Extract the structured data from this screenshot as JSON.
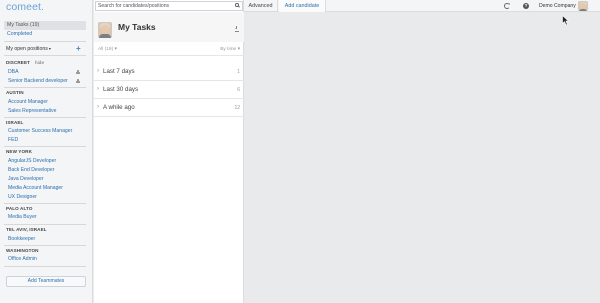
{
  "app": {
    "logo_text": "comeet."
  },
  "sidebar": {
    "nav": [
      {
        "label": "My Tasks (19)",
        "active": true
      },
      {
        "label": "Completed",
        "active": false
      }
    ],
    "positions_header": "My open positions",
    "add_position_label": "+",
    "groups": [
      {
        "label": "DISCREET",
        "hide_label": "hide",
        "items": [
          {
            "label": "DBA",
            "locked": true
          },
          {
            "label": "Senior Backend developer",
            "locked": true
          }
        ]
      },
      {
        "label": "AUSTIN",
        "items": [
          {
            "label": "Account Manager"
          },
          {
            "label": "Sales Representative"
          }
        ]
      },
      {
        "label": "ISRAEL",
        "items": [
          {
            "label": "Customer Success Manager"
          },
          {
            "label": "FED"
          }
        ]
      },
      {
        "label": "NEW YORK",
        "items": [
          {
            "label": "AngularJS Developer"
          },
          {
            "label": "Back End Developer"
          },
          {
            "label": "Java Developer"
          },
          {
            "label": "Media Account Manager"
          },
          {
            "label": "UX Designer"
          }
        ]
      },
      {
        "label": "PALO ALTO",
        "items": [
          {
            "label": "Media Buyer"
          }
        ]
      },
      {
        "label": "TEL AVIV, ISRAEL",
        "items": [
          {
            "label": "Bookkeeper"
          }
        ]
      },
      {
        "label": "WASHINGTON",
        "items": [
          {
            "label": "Office Admin"
          }
        ]
      }
    ],
    "add_teammates_label": "Add Teammates"
  },
  "tasks": {
    "search_placeholder": "Search for candidates/positions",
    "title": "My Tasks",
    "filter_label": "All (19)",
    "sort_label": "By time",
    "groups": [
      {
        "label": "Last 7 days",
        "count": "1"
      },
      {
        "label": "Last 30 days",
        "count": "6"
      },
      {
        "label": "A while ago",
        "count": "12"
      }
    ]
  },
  "topbar": {
    "advanced_label": "Advanced",
    "add_candidate_label": "Add candidate",
    "help_glyph": "?",
    "company_name": "Demo Company"
  },
  "colors": {
    "brand": "#3d7fc1",
    "link": "#2c6fb0",
    "sidebar_bg": "#f4f5f6",
    "canvas_bg": "#e9eaec"
  },
  "icons": [
    "search-icon",
    "download-icon",
    "refresh-icon",
    "help-icon",
    "lock-icon",
    "chevron-right-icon",
    "plus-icon"
  ]
}
